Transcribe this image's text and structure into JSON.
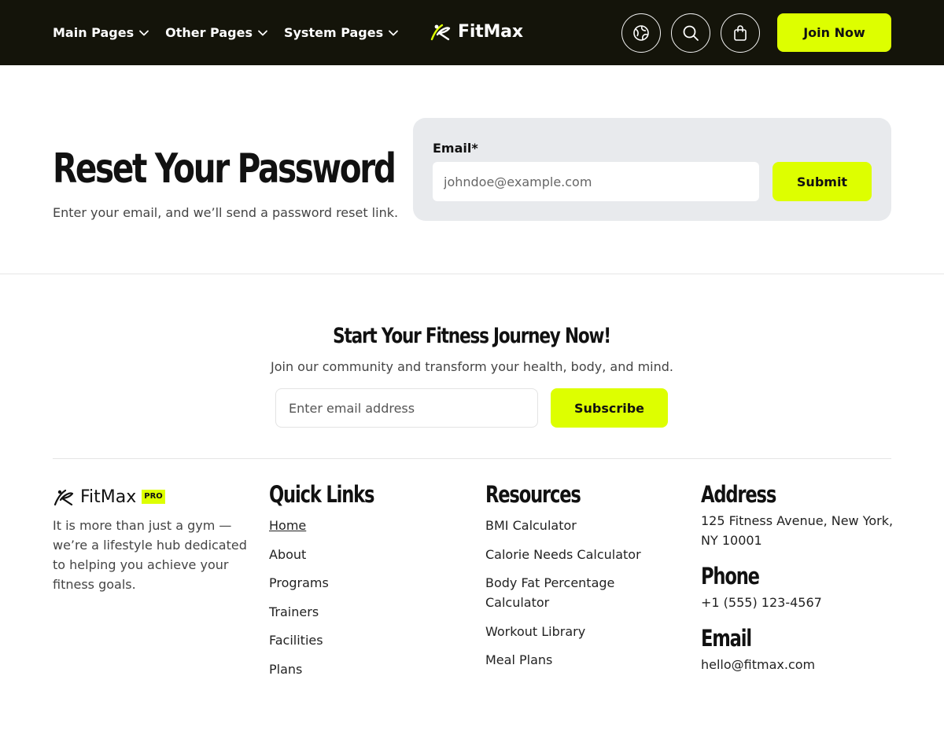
{
  "nav": {
    "menu": [
      {
        "label": "Main Pages"
      },
      {
        "label": "Other Pages"
      },
      {
        "label": "System Pages"
      }
    ],
    "brand": "FitMax",
    "join_label": "Join Now",
    "icons": [
      "globe-icon",
      "search-icon",
      "shopping-bag-icon"
    ]
  },
  "hero": {
    "title": "Reset Your Password",
    "subtitle": "Enter your email, and we’ll send a password reset link."
  },
  "reset_form": {
    "label": "Email*",
    "placeholder": "johndoe@example.com",
    "submit_label": "Submit"
  },
  "newsletter": {
    "title": "Start Your Fitness Journey Now!",
    "subtitle": "Join our community and transform your health, body, and mind.",
    "placeholder": "Enter email address",
    "button_label": "Subscribe"
  },
  "footer": {
    "brand": "FitMax",
    "badge": "PRO",
    "description": "It is more than just a gym — we’re a lifestyle hub dedicated to helping you achieve your fitness goals.",
    "quick_links": {
      "title": "Quick Links",
      "items": [
        "Home",
        "About",
        "Programs",
        "Trainers",
        "Facilities",
        "Plans"
      ]
    },
    "resources": {
      "title": "Resources",
      "items": [
        "BMI Calculator",
        "Calorie Needs Calculator",
        "Body Fat Percentage Calculator",
        "Workout Library",
        "Meal Plans"
      ]
    },
    "address": {
      "title": "Address",
      "text": "125 Fitness Avenue, New York, NY 10001"
    },
    "phone": {
      "title": "Phone",
      "text": "+1 (555) 123-4567"
    },
    "email": {
      "title": "Email",
      "text": "hello@fitmax.com"
    }
  },
  "colors": {
    "accent": "#ddff00",
    "nav_bg": "#14140a",
    "card_bg": "#e8eaed"
  }
}
